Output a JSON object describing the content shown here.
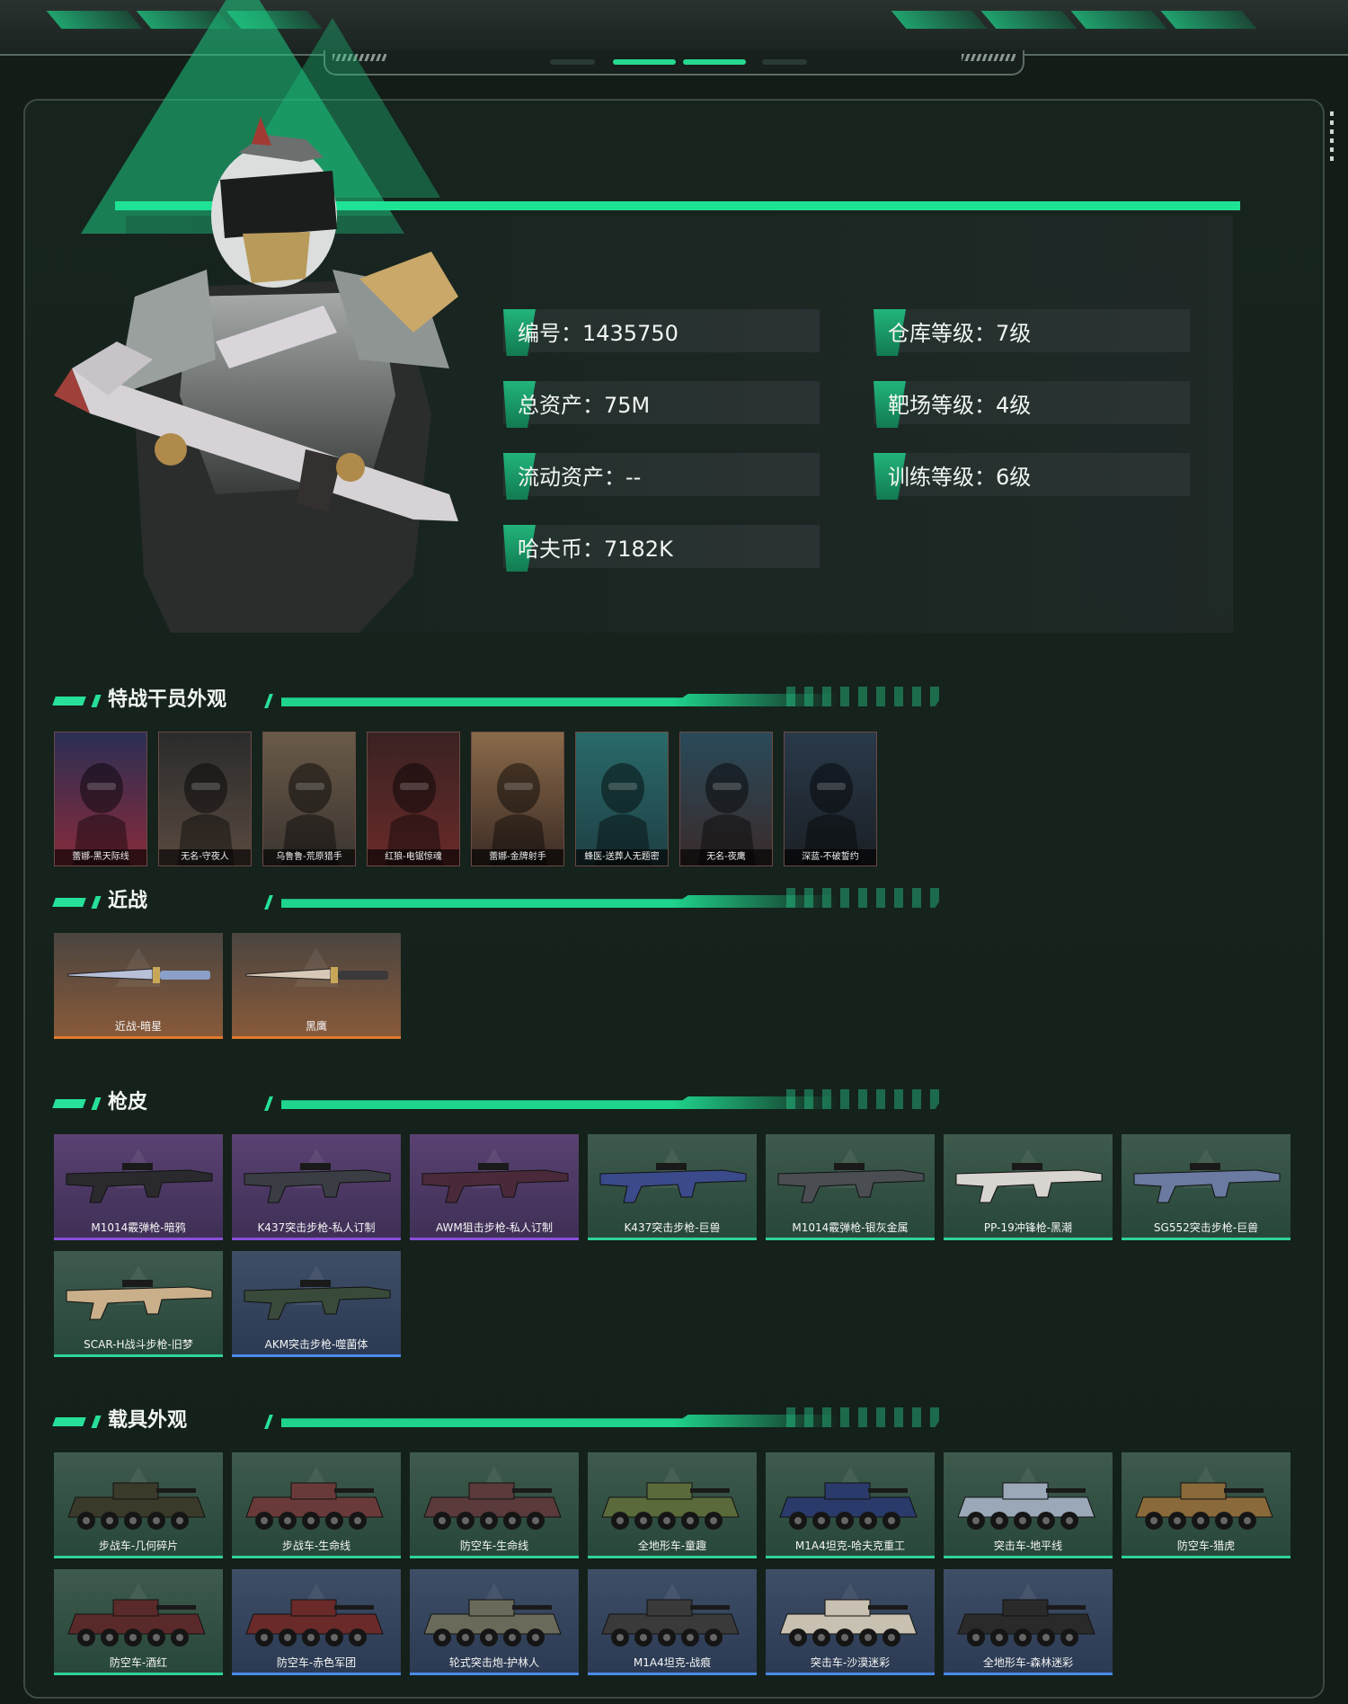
{
  "profile": {
    "stats": [
      {
        "label": "编号：1435750"
      },
      {
        "label": "仓库等级：7级"
      },
      {
        "label": "总资产：75M"
      },
      {
        "label": "靶场等级：4级"
      },
      {
        "label": "流动资产：--"
      },
      {
        "label": "训练等级：6级"
      },
      {
        "label": "哈夫币：7182K"
      }
    ]
  },
  "sections": {
    "agents": {
      "title": "特战干员外观",
      "items": [
        {
          "name": "蕾娜-黑天际线"
        },
        {
          "name": "无名-守夜人"
        },
        {
          "name": "乌鲁鲁-荒原猎手"
        },
        {
          "name": "红狼-电锯惊魂"
        },
        {
          "name": "蕾娜-金牌射手"
        },
        {
          "name": "蜂医-送葬人无题密"
        },
        {
          "name": "无名-夜鹰"
        },
        {
          "name": "深蓝-不破誓约"
        }
      ]
    },
    "melee": {
      "title": "近战",
      "items": [
        {
          "name": "近战-暗星"
        },
        {
          "name": "黑鹰"
        }
      ]
    },
    "skins": {
      "title": "枪皮",
      "items": [
        {
          "name": "M1014霰弹枪-暗鸦",
          "rarity": "purple"
        },
        {
          "name": "K437突击步枪-私人订制",
          "rarity": "purple"
        },
        {
          "name": "AWM狙击步枪-私人订制",
          "rarity": "purple"
        },
        {
          "name": "K437突击步枪-巨兽",
          "rarity": "green"
        },
        {
          "name": "M1014霰弹枪-银灰金属",
          "rarity": "green"
        },
        {
          "name": "PP-19冲锋枪-黑潮",
          "rarity": "green"
        },
        {
          "name": "SG552突击步枪-巨兽",
          "rarity": "green"
        },
        {
          "name": "SCAR-H战斗步枪-旧梦",
          "rarity": "green"
        },
        {
          "name": "AKM突击步枪-噬菌体",
          "rarity": "blue"
        }
      ]
    },
    "vehicles": {
      "title": "载具外观",
      "items": [
        {
          "name": "步战车-几何碎片",
          "rarity": "green"
        },
        {
          "name": "步战车-生命线",
          "rarity": "green"
        },
        {
          "name": "防空车-生命线",
          "rarity": "green"
        },
        {
          "name": "全地形车-童趣",
          "rarity": "green"
        },
        {
          "name": "M1A4坦克-哈夫克重工",
          "rarity": "green"
        },
        {
          "name": "突击车-地平线",
          "rarity": "green"
        },
        {
          "name": "防空车-猎虎",
          "rarity": "green"
        },
        {
          "name": "防空车-酒红",
          "rarity": "green"
        },
        {
          "name": "防空车-赤色军团",
          "rarity": "blue"
        },
        {
          "name": "轮式突击炮-护林人",
          "rarity": "blue"
        },
        {
          "name": "M1A4坦克-战痕",
          "rarity": "blue"
        },
        {
          "name": "突击车-沙漠迷彩",
          "rarity": "blue"
        },
        {
          "name": "全地形车-森林迷彩",
          "rarity": "blue"
        }
      ]
    }
  },
  "colors": {
    "accent": "#1fe394",
    "rarity_purple": "#8a4fd8",
    "rarity_green": "#2fd39a",
    "rarity_blue": "#4a8ae8",
    "rarity_orange": "#e07a2a"
  }
}
